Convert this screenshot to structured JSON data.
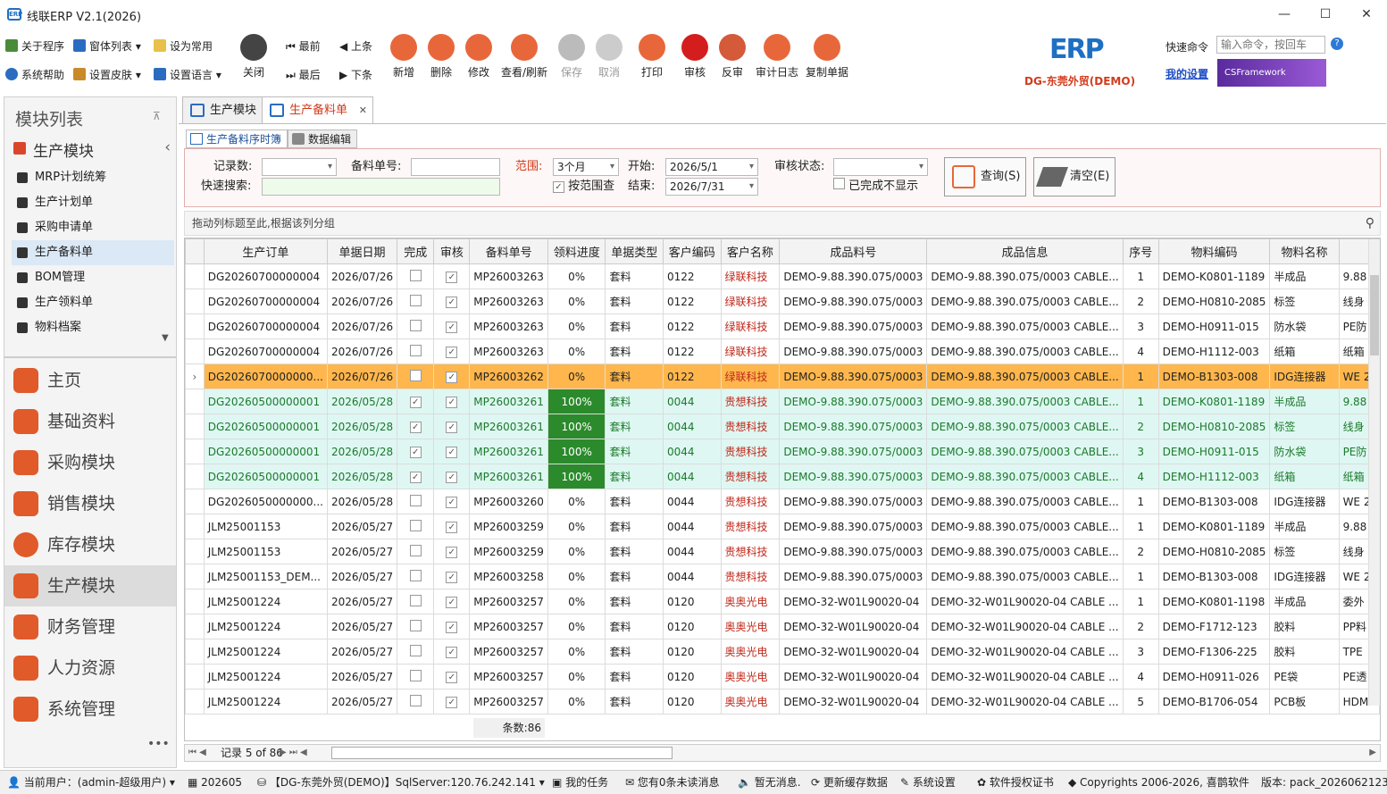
{
  "app": {
    "title": "线联ERP V2.1(2026)",
    "minimize": "—",
    "maximize": "☐",
    "close": "✕"
  },
  "ribbon": {
    "about": "关于程序",
    "window_list": "窗体列表",
    "set_common": "设为常用",
    "help": "系统帮助",
    "skin": "设置皮肤",
    "language": "设置语言",
    "close": "关闭",
    "first": "最前",
    "prev": "上条",
    "last": "最后",
    "next": "下条",
    "new": "新增",
    "delete": "删除",
    "edit": "修改",
    "query_refresh": "查看/刷新",
    "save": "保存",
    "cancel": "取消",
    "print": "打印",
    "approve": "审核",
    "unapprove": "反审",
    "audit_log": "审计日志",
    "copy_doc": "复制单据",
    "company": "DG-东莞外贸(DEMO)",
    "quick_cmd_label": "快速命令",
    "quick_cmd_placeholder": "输入命令，按回车",
    "my_settings": "我的设置",
    "banner": "CSFramework"
  },
  "sidebar": {
    "header": "模块列表",
    "pin": "⊼",
    "group": "生产模块",
    "items": [
      "MRP计划统筹",
      "生产计划单",
      "采购申请单",
      "生产备料单",
      "BOM管理",
      "生产领料单",
      "物料档案"
    ],
    "modules": [
      "主页",
      "基础资料",
      "采购模块",
      "销售模块",
      "库存模块",
      "生产模块",
      "财务管理",
      "人力资源",
      "系统管理"
    ],
    "more": "•••"
  },
  "tabs": [
    "生产模块",
    "生产备料单"
  ],
  "subtabs": [
    "生产备料序时簿",
    "数据编辑"
  ],
  "filter": {
    "record_count": "记录数:",
    "doc_no": "备料单号:",
    "range_label": "范围:",
    "range_value": "3个月",
    "start_label": "开始:",
    "start": "2026/5/1",
    "end_label": "结束:",
    "end": "2026/7/31",
    "status_label": "审核状态:",
    "quick_search": "快速搜索:",
    "by_range": "按范围查",
    "hide_done": "已完成不显示",
    "query_btn": "查询(S)",
    "clear_btn": "清空(E)"
  },
  "group_hint": "拖动列标题至此,根据该列分组",
  "columns": [
    "生产订单",
    "单据日期",
    "完成",
    "审核",
    "备料单号",
    "领料进度",
    "单据类型",
    "客户编码",
    "客户名称",
    "成品料号",
    "成品信息",
    "序号",
    "物料编码",
    "物料名称",
    ""
  ],
  "rows": [
    [
      "DG20260700000004",
      "2026/07/26",
      false,
      true,
      "MP26003263",
      "0%",
      "套料",
      "0122",
      "绿联科技",
      "DEMO-9.88.390.075/0003",
      "DEMO-9.88.390.075/0003 CABLE...",
      "1",
      "DEMO-K0801-1189",
      "半成品",
      "9.88"
    ],
    [
      "DG20260700000004",
      "2026/07/26",
      false,
      true,
      "MP26003263",
      "0%",
      "套料",
      "0122",
      "绿联科技",
      "DEMO-9.88.390.075/0003",
      "DEMO-9.88.390.075/0003 CABLE...",
      "2",
      "DEMO-H0810-2085",
      "标签",
      "线身"
    ],
    [
      "DG20260700000004",
      "2026/07/26",
      false,
      true,
      "MP26003263",
      "0%",
      "套料",
      "0122",
      "绿联科技",
      "DEMO-9.88.390.075/0003",
      "DEMO-9.88.390.075/0003 CABLE...",
      "3",
      "DEMO-H0911-015",
      "防水袋",
      "PE防"
    ],
    [
      "DG20260700000004",
      "2026/07/26",
      false,
      true,
      "MP26003263",
      "0%",
      "套料",
      "0122",
      "绿联科技",
      "DEMO-9.88.390.075/0003",
      "DEMO-9.88.390.075/0003 CABLE...",
      "4",
      "DEMO-H1112-003",
      "纸箱",
      "纸箱"
    ],
    [
      "DG2026070000000...",
      "2026/07/26",
      false,
      true,
      "MP26003262",
      "0%",
      "套料",
      "0122",
      "绿联科技",
      "DEMO-9.88.390.075/0003",
      "DEMO-9.88.390.075/0003 CABLE...",
      "1",
      "DEMO-B1303-008",
      "IDG连接器",
      "WE 2"
    ],
    [
      "DG20260500000001",
      "2026/05/28",
      true,
      true,
      "MP26003261",
      "100%",
      "套料",
      "0044",
      "贵想科技",
      "DEMO-9.88.390.075/0003",
      "DEMO-9.88.390.075/0003 CABLE...",
      "1",
      "DEMO-K0801-1189",
      "半成品",
      "9.88"
    ],
    [
      "DG20260500000001",
      "2026/05/28",
      true,
      true,
      "MP26003261",
      "100%",
      "套料",
      "0044",
      "贵想科技",
      "DEMO-9.88.390.075/0003",
      "DEMO-9.88.390.075/0003 CABLE...",
      "2",
      "DEMO-H0810-2085",
      "标签",
      "线身"
    ],
    [
      "DG20260500000001",
      "2026/05/28",
      true,
      true,
      "MP26003261",
      "100%",
      "套料",
      "0044",
      "贵想科技",
      "DEMO-9.88.390.075/0003",
      "DEMO-9.88.390.075/0003 CABLE...",
      "3",
      "DEMO-H0911-015",
      "防水袋",
      "PE防"
    ],
    [
      "DG20260500000001",
      "2026/05/28",
      true,
      true,
      "MP26003261",
      "100%",
      "套料",
      "0044",
      "贵想科技",
      "DEMO-9.88.390.075/0003",
      "DEMO-9.88.390.075/0003 CABLE...",
      "4",
      "DEMO-H1112-003",
      "纸箱",
      "纸箱"
    ],
    [
      "DG2026050000000...",
      "2026/05/28",
      false,
      true,
      "MP26003260",
      "0%",
      "套料",
      "0044",
      "贵想科技",
      "DEMO-9.88.390.075/0003",
      "DEMO-9.88.390.075/0003 CABLE...",
      "1",
      "DEMO-B1303-008",
      "IDG连接器",
      "WE 2"
    ],
    [
      "JLM25001153",
      "2026/05/27",
      false,
      true,
      "MP26003259",
      "0%",
      "套料",
      "0044",
      "贵想科技",
      "DEMO-9.88.390.075/0003",
      "DEMO-9.88.390.075/0003 CABLE...",
      "1",
      "DEMO-K0801-1189",
      "半成品",
      "9.88"
    ],
    [
      "JLM25001153",
      "2026/05/27",
      false,
      true,
      "MP26003259",
      "0%",
      "套料",
      "0044",
      "贵想科技",
      "DEMO-9.88.390.075/0003",
      "DEMO-9.88.390.075/0003 CABLE...",
      "2",
      "DEMO-H0810-2085",
      "标签",
      "线身"
    ],
    [
      "JLM25001153_DEM...",
      "2026/05/27",
      false,
      true,
      "MP26003258",
      "0%",
      "套料",
      "0044",
      "贵想科技",
      "DEMO-9.88.390.075/0003",
      "DEMO-9.88.390.075/0003 CABLE...",
      "1",
      "DEMO-B1303-008",
      "IDG连接器",
      "WE 2"
    ],
    [
      "JLM25001224",
      "2026/05/27",
      false,
      true,
      "MP26003257",
      "0%",
      "套料",
      "0120",
      "奥奥光电",
      "DEMO-32-W01L90020-04",
      "DEMO-32-W01L90020-04 CABLE ...",
      "1",
      "DEMO-K0801-1198",
      "半成品",
      "委外"
    ],
    [
      "JLM25001224",
      "2026/05/27",
      false,
      true,
      "MP26003257",
      "0%",
      "套料",
      "0120",
      "奥奥光电",
      "DEMO-32-W01L90020-04",
      "DEMO-32-W01L90020-04 CABLE ...",
      "2",
      "DEMO-F1712-123",
      "胶料",
      "PP料"
    ],
    [
      "JLM25001224",
      "2026/05/27",
      false,
      true,
      "MP26003257",
      "0%",
      "套料",
      "0120",
      "奥奥光电",
      "DEMO-32-W01L90020-04",
      "DEMO-32-W01L90020-04 CABLE ...",
      "3",
      "DEMO-F1306-225",
      "胶料",
      "TPE"
    ],
    [
      "JLM25001224",
      "2026/05/27",
      false,
      true,
      "MP26003257",
      "0%",
      "套料",
      "0120",
      "奥奥光电",
      "DEMO-32-W01L90020-04",
      "DEMO-32-W01L90020-04 CABLE ...",
      "4",
      "DEMO-H0911-026",
      "PE袋",
      "PE透"
    ],
    [
      "JLM25001224",
      "2026/05/27",
      false,
      true,
      "MP26003257",
      "0%",
      "套料",
      "0120",
      "奥奥光电",
      "DEMO-32-W01L90020-04",
      "DEMO-32-W01L90020-04 CABLE ...",
      "5",
      "DEMO-B1706-054",
      "PCB板",
      "HDM"
    ]
  ],
  "selected_row": 4,
  "footer": {
    "count": "条数:86",
    "record": "记录 5 of 86"
  },
  "status": {
    "user": "当前用户：(admin-超级用户)",
    "period": "202605",
    "db": "【DG-东莞外贸(DEMO)】SqlServer:120.76.242.141",
    "tasks": "我的任务",
    "messages": "您有0条未读消息",
    "notice": "暂无消息.",
    "cache": "更新缓存数据",
    "settings": "系统设置",
    "license": "软件授权证书",
    "copyright": "Copyrights 2006-2026, 喜鹊软件",
    "version": "版本: pack_2026062123"
  },
  "colors": {
    "accent": "#d23b1b",
    "selected": "#ffb74d",
    "done_bg": "#dff7f3",
    "done_text": "#1a7a2a",
    "progress_full": "#2b8a2b",
    "red_text": "#c0281a"
  }
}
